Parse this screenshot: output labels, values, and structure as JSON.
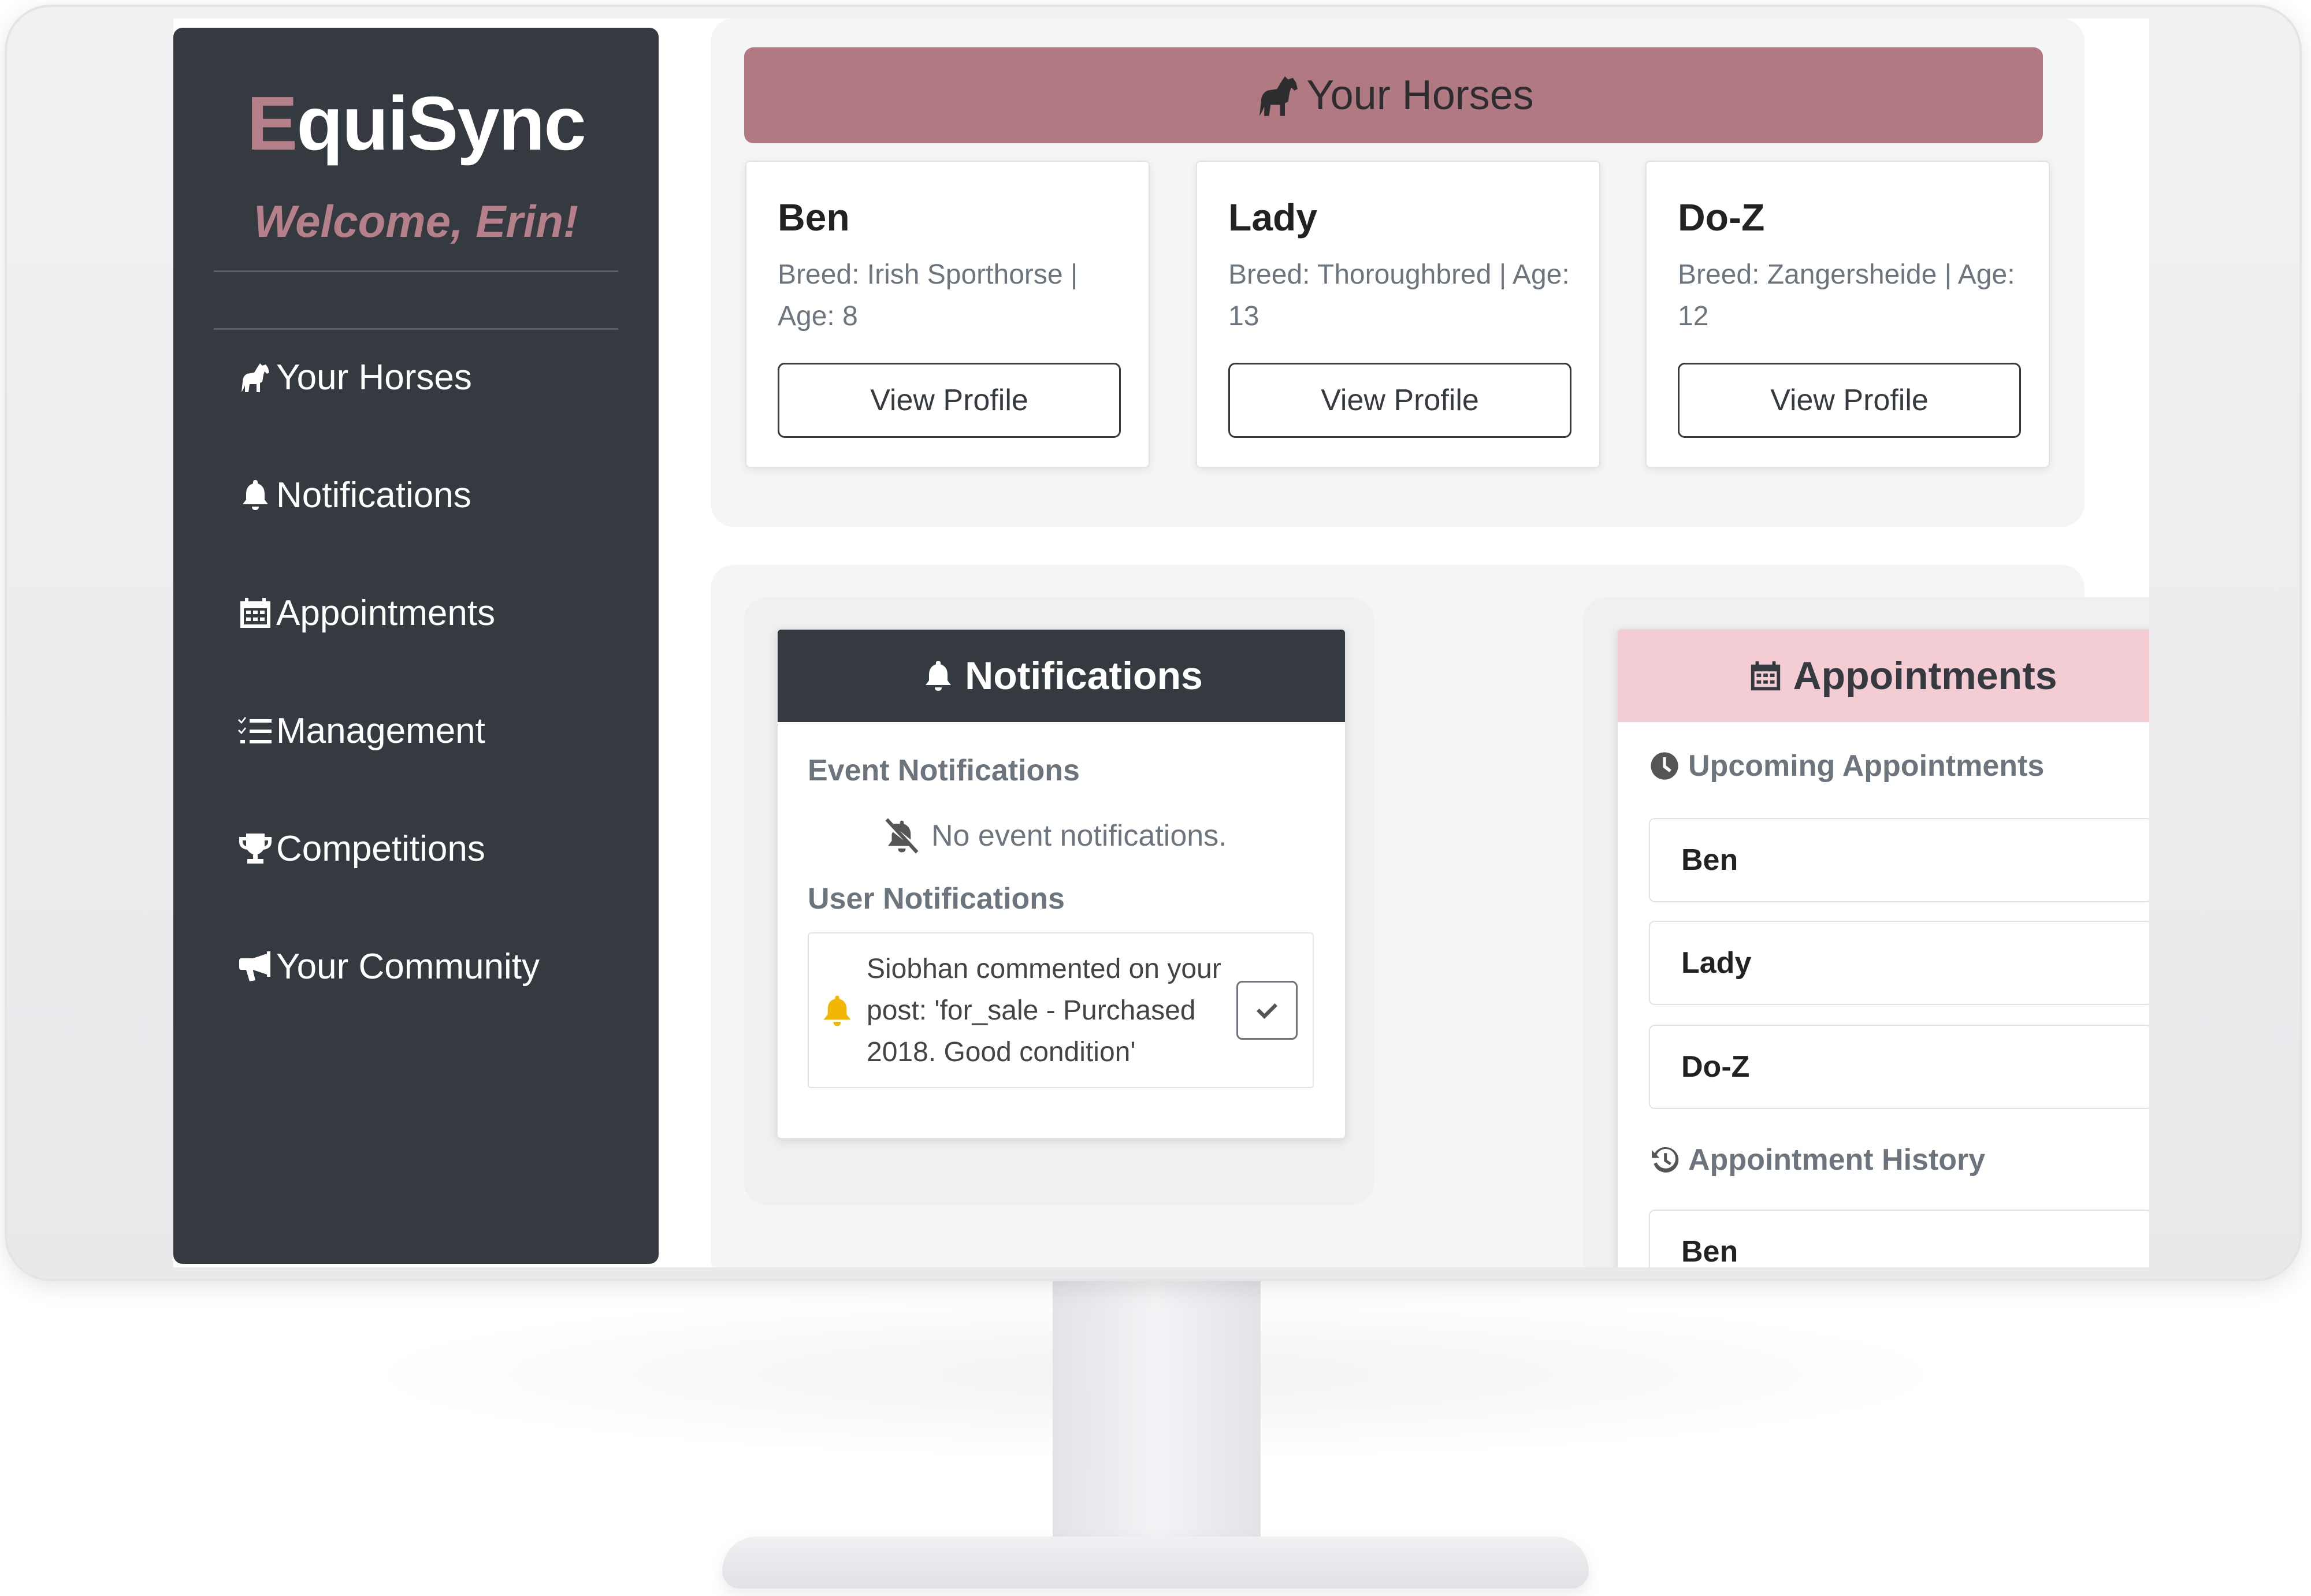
{
  "app": {
    "brand_first": "E",
    "brand_rest": "quiSync",
    "welcome": "Welcome, Erin!"
  },
  "sidebar": {
    "items": [
      {
        "label": "Your Horses",
        "icon": "horse-icon"
      },
      {
        "label": "Notifications",
        "icon": "bell-icon"
      },
      {
        "label": "Appointments",
        "icon": "calendar-icon"
      },
      {
        "label": "Management",
        "icon": "list-check-icon"
      },
      {
        "label": "Competitions",
        "icon": "trophy-icon"
      },
      {
        "label": "Your Community",
        "icon": "megaphone-icon"
      }
    ]
  },
  "horses": {
    "title": "Your Horses",
    "cards": [
      {
        "name": "Ben",
        "info": "Breed: Irish Sporthorse | Age: 8",
        "button": "View Profile"
      },
      {
        "name": "Lady",
        "info": "Breed: Thoroughbred | Age: 13",
        "button": "View Profile"
      },
      {
        "name": "Do-Z",
        "info": "Breed: Zangersheide | Age: 12",
        "button": "View Profile"
      }
    ]
  },
  "notifications": {
    "title": "Notifications",
    "event_heading": "Event Notifications",
    "event_empty": "No event notifications.",
    "user_heading": "User Notifications",
    "user_items": [
      {
        "message": "Siobhan commented on your post: 'for_sale - Purchased 2018. Good condition'"
      }
    ]
  },
  "appointments": {
    "title": "Appointments",
    "upcoming_heading": "Upcoming Appointments",
    "upcoming": [
      "Ben",
      "Lady",
      "Do-Z"
    ],
    "history_heading": "Appointment History",
    "history": [
      "Ben"
    ]
  },
  "colors": {
    "sidebar_bg": "#343a40",
    "brand_accent": "#b5808a",
    "horses_banner": "#b17a83",
    "appointments_header": "#f4ccd3",
    "bell_accent": "#f2b705"
  }
}
